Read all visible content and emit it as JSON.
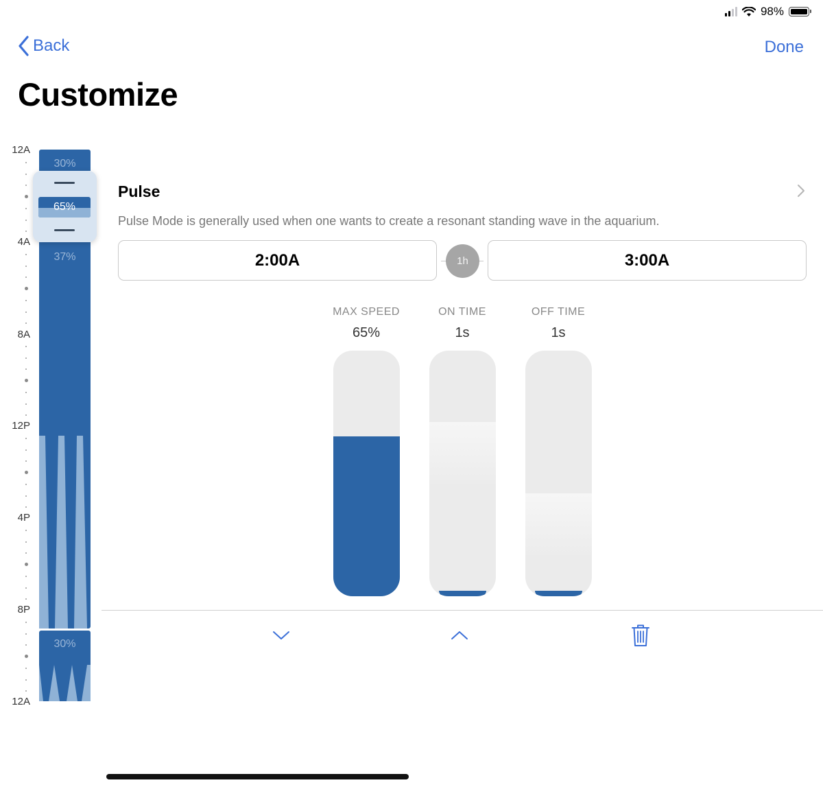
{
  "status_bar": {
    "battery": "98%",
    "signal_bars": 4,
    "signal_active": 2
  },
  "nav": {
    "back_label": "Back",
    "done_label": "Done"
  },
  "page": {
    "title": "Customize"
  },
  "timeline": {
    "hour_labels": [
      "12A",
      "4A",
      "8A",
      "12P",
      "4P",
      "8P",
      "12A"
    ],
    "segments": [
      {
        "label": "30%"
      },
      {
        "label": "65%"
      },
      {
        "label": "37%"
      },
      {
        "label": "30%"
      }
    ],
    "colors": {
      "dark": "#2c65a6",
      "light": "#8fb2d6",
      "handle": "#d8e4f1"
    }
  },
  "detail": {
    "mode": "Pulse",
    "description": "Pulse Mode is generally used when one wants to create a resonant standing wave in the aquarium.",
    "start_time": "2:00A",
    "end_time": "3:00A",
    "duration": "1h",
    "controls": [
      {
        "title": "MAX SPEED",
        "value": "65%",
        "level": 0.65
      },
      {
        "title": "ON TIME",
        "value": "1s",
        "level": 0.71
      },
      {
        "title": "OFF TIME",
        "value": "1s",
        "level": 0.42
      }
    ]
  },
  "toolbar": {
    "icons": [
      "chevron-down-icon",
      "chevron-up-icon",
      "trash-icon"
    ]
  },
  "theme": {
    "accent": "#3b6fd8",
    "slider_fill": "#2c65a6",
    "slider_track": "#ebebeb"
  }
}
